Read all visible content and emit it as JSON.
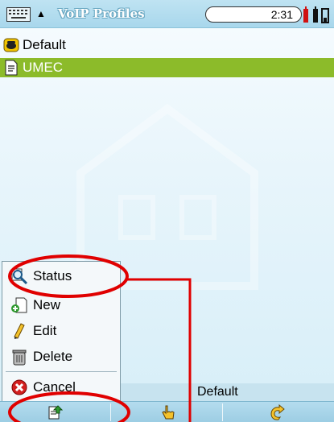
{
  "titlebar": {
    "title": "VoIP Profiles",
    "time": "2:31"
  },
  "profiles": [
    {
      "label": "Default",
      "icon": "phone-icon",
      "selected": false
    },
    {
      "label": "UMEC",
      "icon": "document-icon",
      "selected": true
    }
  ],
  "menu": {
    "items": [
      {
        "label": "Status",
        "icon": "magnifier-icon"
      },
      {
        "label": "New",
        "icon": "new-document-icon"
      },
      {
        "label": "Edit",
        "icon": "pencil-icon"
      },
      {
        "label": "Delete",
        "icon": "trash-icon"
      },
      {
        "label": "Cancel",
        "icon": "cancel-icon"
      }
    ]
  },
  "status": {
    "default_label": "Default"
  },
  "colors": {
    "selection": "#8cbb2a",
    "annotation": "#e00000"
  }
}
